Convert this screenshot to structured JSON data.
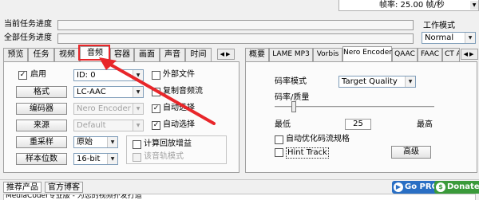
{
  "top": {
    "framerate_text": "帧率: 25.00 帧/秒",
    "progress_current_label": "当前任务进度",
    "progress_all_label": "全部任务进度",
    "work_mode_label": "工作模式",
    "work_mode_value": "Normal"
  },
  "left": {
    "tabs": [
      "预览",
      "任务",
      "视频",
      "音频",
      "容器",
      "画面",
      "声音",
      "时间"
    ],
    "active_tab": "音频",
    "enable_label": "启用",
    "enable_checked": "✓",
    "enable_value": "ID: 0",
    "external_file_label": "外部文件",
    "format_button": "格式",
    "format_value": "LC-AAC",
    "copy_stream_label": "复制音频流",
    "encoder_button": "编码器",
    "encoder_value": "Nero Encoder",
    "auto_select_1_label": "自动选择",
    "auto_select_1_checked": "✓",
    "source_button": "来源",
    "source_value": "Default",
    "auto_select_2_label": "自动选择",
    "auto_select_2_checked": "✓",
    "resample_button": "重采样",
    "resample_value": "原始",
    "calc_gain_label": "计算回放增益",
    "bit_depth_button": "样本位数",
    "bit_depth_value": "16-bit",
    "track_mode_label": "该音轨模式"
  },
  "right": {
    "tabs": [
      "概要",
      "LAME MP3",
      "Vorbis",
      "Nero Encoder",
      "QAAC",
      "FAAC",
      "CT AAC"
    ],
    "active_tab": "Nero Encoder",
    "rate_mode_label": "码率模式",
    "rate_mode_value": "Target Quality",
    "rate_quality_label": "码率/质量",
    "slider_position": 0.12,
    "min_label": "最低",
    "quality_value": "25",
    "max_label": "最高",
    "optimize_label": "自动优化码流规格",
    "hint_track_label": "Hint Track",
    "advanced_button": "高级"
  },
  "footer": {
    "tab_recommend": "推荐产品",
    "tab_blog": "官方博客",
    "gopro_label": "Go PRO",
    "donate_label": "Donate",
    "status_text": "MediaCoder专业版 - 为您的视频扑发打造"
  },
  "colors": {
    "highlight_red": "#e8262a",
    "gopro_blue": "#2a6fc4",
    "donate_green": "#3a9a3a"
  }
}
